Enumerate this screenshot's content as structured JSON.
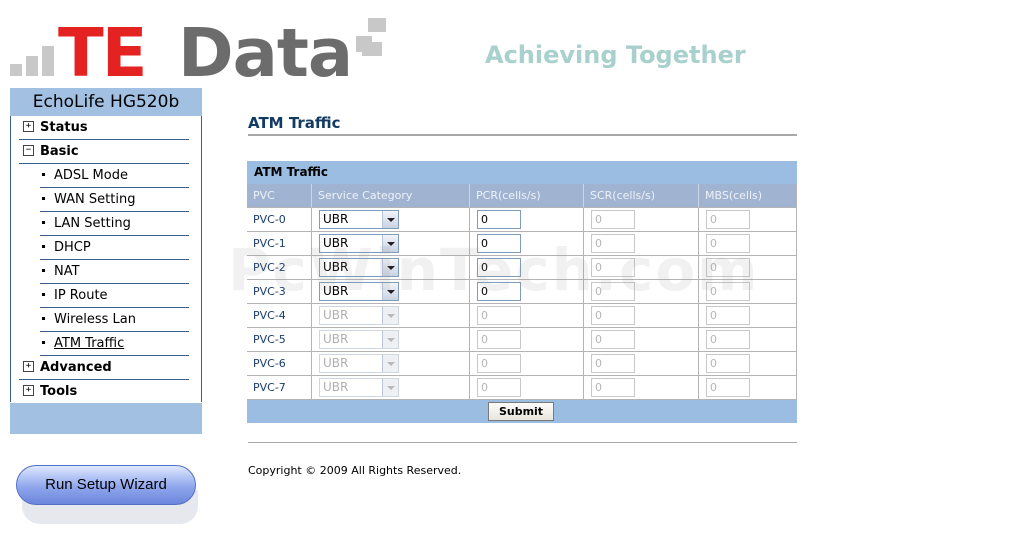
{
  "brand": {
    "logo_te": "TE",
    "logo_data": "Data",
    "slogan": "Achieving Together",
    "watermark": "PcWinTech.com"
  },
  "sidebar": {
    "device": "EchoLife HG520b",
    "items": [
      {
        "label": "Status",
        "expander": "+"
      },
      {
        "label": "Basic",
        "expander": "−"
      },
      {
        "label": "ADSL Mode"
      },
      {
        "label": "WAN Setting"
      },
      {
        "label": "LAN Setting"
      },
      {
        "label": "DHCP"
      },
      {
        "label": "NAT"
      },
      {
        "label": "IP Route"
      },
      {
        "label": "Wireless Lan"
      },
      {
        "label": "ATM Traffic"
      },
      {
        "label": "Advanced",
        "expander": "+"
      },
      {
        "label": "Tools",
        "expander": "+"
      }
    ],
    "wizard_label": "Run Setup Wizard"
  },
  "main": {
    "page_title": "ATM Traffic",
    "table_title": "ATM Traffic",
    "columns": [
      "PVC",
      "Service Category",
      "PCR(cells/s)",
      "SCR(cells/s)",
      "MBS(cells)"
    ],
    "rows": [
      {
        "pvc": "PVC-0",
        "category": "UBR",
        "pcr": "0",
        "scr": "0",
        "mbs": "0"
      },
      {
        "pvc": "PVC-1",
        "category": "UBR",
        "pcr": "0",
        "scr": "0",
        "mbs": "0"
      },
      {
        "pvc": "PVC-2",
        "category": "UBR",
        "pcr": "0",
        "scr": "0",
        "mbs": "0"
      },
      {
        "pvc": "PVC-3",
        "category": "UBR",
        "pcr": "0",
        "scr": "0",
        "mbs": "0"
      },
      {
        "pvc": "PVC-4",
        "category": "UBR",
        "pcr": "0",
        "scr": "0",
        "mbs": "0"
      },
      {
        "pvc": "PVC-5",
        "category": "UBR",
        "pcr": "0",
        "scr": "0",
        "mbs": "0"
      },
      {
        "pvc": "PVC-6",
        "category": "UBR",
        "pcr": "0",
        "scr": "0",
        "mbs": "0"
      },
      {
        "pvc": "PVC-7",
        "category": "UBR",
        "pcr": "0",
        "scr": "0",
        "mbs": "0"
      }
    ],
    "submit_label": "Submit",
    "copyright": "Copyright © 2009 All Rights Reserved."
  },
  "colors": {
    "brand_red": "#e52222",
    "brand_gray": "#6c6c6c",
    "slogan": "#a8d0cc",
    "nav_blue": "#a1c0e2",
    "title_navy": "#123a63"
  }
}
